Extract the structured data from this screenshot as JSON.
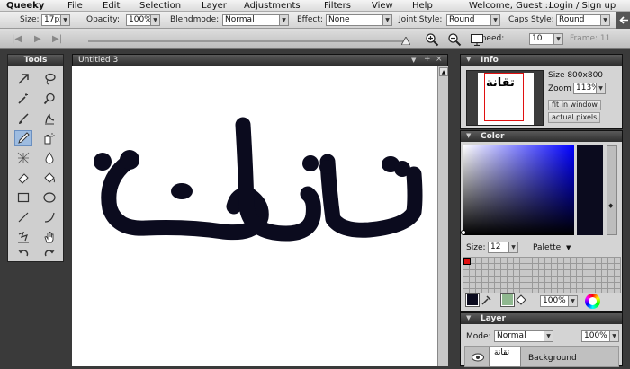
{
  "menubar": {
    "brand": "Queeky",
    "items": [
      "File",
      "Edit",
      "Selection",
      "Layer",
      "Adjustments",
      "Filters",
      "View",
      "Help"
    ],
    "welcome": "Welcome, Guest ::",
    "login": "Login",
    "signup": "/ Sign up"
  },
  "options": {
    "size_label": "Size:",
    "size_value": "17px",
    "opacity_label": "Opacity:",
    "opacity_value": "100%",
    "blendmode_label": "Blendmode:",
    "blendmode_value": "Normal",
    "effect_label": "Effect:",
    "effect_value": "None",
    "joint_label": "Joint Style:",
    "joint_value": "Round",
    "caps_label": "Caps Style:",
    "caps_value": "Round"
  },
  "animation": {
    "speed_label": "Speed:",
    "speed_value": "10",
    "frame_label": "Frame: 11"
  },
  "tools": {
    "title": "Tools",
    "items": [
      "arrow",
      "lasso",
      "magic-wand",
      "zoom",
      "brush",
      "smudge",
      "pencil",
      "spray",
      "crop",
      "blur",
      "eraser",
      "fill",
      "rectangle",
      "ellipse",
      "line",
      "curve",
      "clone",
      "hand",
      "undo",
      "redo"
    ]
  },
  "document": {
    "title": "Untitled 3",
    "drawing_text": "تقانة",
    "ink_color": "#0b0b1e"
  },
  "info": {
    "title": "Info",
    "thumb_text": "تقانة",
    "size_text": "Size  800x800",
    "zoom_label": "Zoom",
    "zoom_value": "113%",
    "fit_label": "fit in window",
    "actual_label": "actual pixels"
  },
  "color": {
    "title": "Color",
    "size_label": "Size:",
    "size_value": "12",
    "palette_label": "Palette",
    "zoom_value": "100%",
    "primary": "#0b0b1e",
    "secondary": "#8fb88f"
  },
  "layer": {
    "title": "Layer",
    "mode_label": "Mode:",
    "mode_value": "Normal",
    "opacity_value": "100%",
    "layer_thumb_text": "تقانة",
    "layer_name": "Background"
  }
}
